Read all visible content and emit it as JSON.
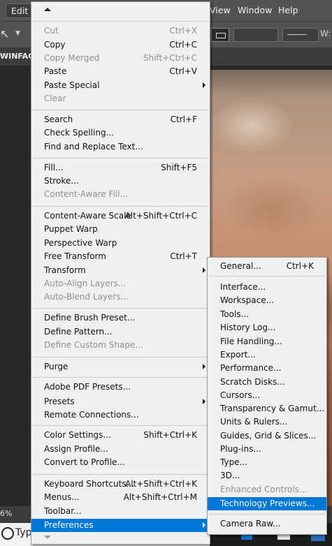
{
  "menubar": {
    "edit": "Edit",
    "view": "View",
    "window": "Window",
    "help": "Help"
  },
  "document_tab": "WINFACE",
  "status": {
    "zoom": "6%"
  },
  "taskbar": {
    "search_text": "Typ"
  },
  "edit_menu": {
    "items": [
      {
        "label": "Cut",
        "shortcut": "Ctrl+X",
        "enabled": false
      },
      {
        "label": "Copy",
        "shortcut": "Ctrl+C",
        "enabled": true
      },
      {
        "label": "Copy Merged",
        "shortcut": "Shift+Ctrl+C",
        "enabled": false
      },
      {
        "label": "Paste",
        "shortcut": "Ctrl+V",
        "enabled": true
      },
      {
        "label": "Paste Special",
        "shortcut": "",
        "enabled": true,
        "submenu": true
      },
      {
        "label": "Clear",
        "shortcut": "",
        "enabled": false
      },
      {
        "label": "Search",
        "shortcut": "Ctrl+F",
        "enabled": true
      },
      {
        "label": "Check Spelling...",
        "shortcut": "",
        "enabled": true
      },
      {
        "label": "Find and Replace Text...",
        "shortcut": "",
        "enabled": true
      },
      {
        "label": "Fill...",
        "shortcut": "Shift+F5",
        "enabled": true
      },
      {
        "label": "Stroke...",
        "shortcut": "",
        "enabled": true
      },
      {
        "label": "Content-Aware Fill...",
        "shortcut": "",
        "enabled": false
      },
      {
        "label": "Content-Aware Scale",
        "shortcut": "Alt+Shift+Ctrl+C",
        "enabled": true
      },
      {
        "label": "Puppet Warp",
        "shortcut": "",
        "enabled": true
      },
      {
        "label": "Perspective Warp",
        "shortcut": "",
        "enabled": true
      },
      {
        "label": "Free Transform",
        "shortcut": "Ctrl+T",
        "enabled": true
      },
      {
        "label": "Transform",
        "shortcut": "",
        "enabled": true,
        "submenu": true
      },
      {
        "label": "Auto-Align Layers...",
        "shortcut": "",
        "enabled": false
      },
      {
        "label": "Auto-Blend Layers...",
        "shortcut": "",
        "enabled": false
      },
      {
        "label": "Define Brush Preset...",
        "shortcut": "",
        "enabled": true
      },
      {
        "label": "Define Pattern...",
        "shortcut": "",
        "enabled": true
      },
      {
        "label": "Define Custom Shape...",
        "shortcut": "",
        "enabled": false
      },
      {
        "label": "Purge",
        "shortcut": "",
        "enabled": true,
        "submenu": true
      },
      {
        "label": "Adobe PDF Presets...",
        "shortcut": "",
        "enabled": true
      },
      {
        "label": "Presets",
        "shortcut": "",
        "enabled": true,
        "submenu": true
      },
      {
        "label": "Remote Connections...",
        "shortcut": "",
        "enabled": true
      },
      {
        "label": "Color Settings...",
        "shortcut": "Shift+Ctrl+K",
        "enabled": true
      },
      {
        "label": "Assign Profile...",
        "shortcut": "",
        "enabled": true
      },
      {
        "label": "Convert to Profile...",
        "shortcut": "",
        "enabled": true
      },
      {
        "label": "Keyboard Shortcuts...",
        "shortcut": "Alt+Shift+Ctrl+K",
        "enabled": true
      },
      {
        "label": "Menus...",
        "shortcut": "Alt+Shift+Ctrl+M",
        "enabled": true
      },
      {
        "label": "Toolbar...",
        "shortcut": "",
        "enabled": true
      },
      {
        "label": "Preferences",
        "shortcut": "",
        "enabled": true,
        "submenu": true,
        "selected": true
      }
    ]
  },
  "preferences_menu": {
    "items": [
      {
        "label": "General...",
        "shortcut": "Ctrl+K",
        "enabled": true
      },
      {
        "label": "Interface...",
        "shortcut": "",
        "enabled": true
      },
      {
        "label": "Workspace...",
        "shortcut": "",
        "enabled": true
      },
      {
        "label": "Tools...",
        "shortcut": "",
        "enabled": true
      },
      {
        "label": "History Log...",
        "shortcut": "",
        "enabled": true
      },
      {
        "label": "File Handling...",
        "shortcut": "",
        "enabled": true
      },
      {
        "label": "Export...",
        "shortcut": "",
        "enabled": true
      },
      {
        "label": "Performance...",
        "shortcut": "",
        "enabled": true
      },
      {
        "label": "Scratch Disks...",
        "shortcut": "",
        "enabled": true
      },
      {
        "label": "Cursors...",
        "shortcut": "",
        "enabled": true
      },
      {
        "label": "Transparency & Gamut...",
        "shortcut": "",
        "enabled": true
      },
      {
        "label": "Units & Rulers...",
        "shortcut": "",
        "enabled": true
      },
      {
        "label": "Guides, Grid & Slices...",
        "shortcut": "",
        "enabled": true
      },
      {
        "label": "Plug-ins...",
        "shortcut": "",
        "enabled": true
      },
      {
        "label": "Type...",
        "shortcut": "",
        "enabled": true
      },
      {
        "label": "3D...",
        "shortcut": "",
        "enabled": true
      },
      {
        "label": "Enhanced Controls...",
        "shortcut": "",
        "enabled": false
      },
      {
        "label": "Technology Previews...",
        "shortcut": "",
        "enabled": true,
        "selected": true
      },
      {
        "label": "Camera Raw...",
        "shortcut": "",
        "enabled": true
      }
    ]
  },
  "colors": {
    "menu_bg": "#f0f0f0",
    "highlight": "#0078d7",
    "disabled_text": "#8f8f8f",
    "app_chrome": "#535353"
  }
}
